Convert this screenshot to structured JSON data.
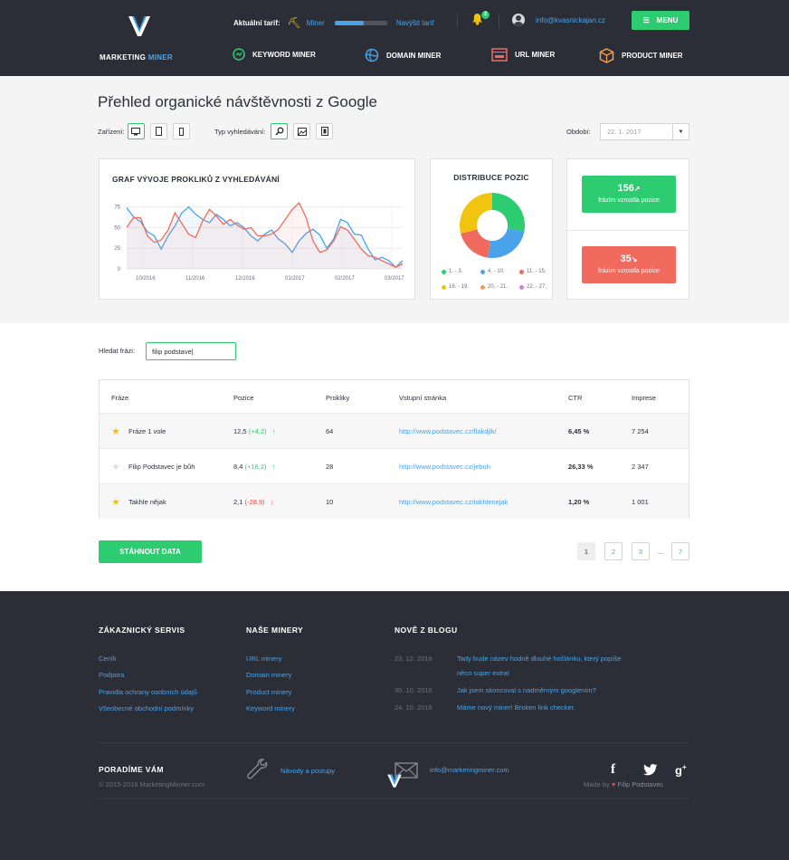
{
  "header": {
    "tariff_label": "Aktuální tarif:",
    "tariff_name": "Miner",
    "tariff_progress": 0.55,
    "upgrade_label": "Navýšit tarif",
    "notifications_count": "2",
    "user_email": "info@kvasnickajan.cz",
    "menu_label": "MENU"
  },
  "brand": {
    "name_part1": "MARKETING",
    "name_part2": "MINER"
  },
  "nav": [
    {
      "label": "KEYWORD MINER",
      "icon": "keyword-miner-icon"
    },
    {
      "label": "DOMAIN MINER",
      "icon": "domain-miner-icon"
    },
    {
      "label": "URL MINER",
      "icon": "url-miner-icon"
    },
    {
      "label": "PRODUCT MINER",
      "icon": "product-miner-icon"
    }
  ],
  "overview": {
    "title": "Přehled organické návštěvnosti z Google",
    "device_label": "Zařízení:",
    "search_type_label": "Typ vyhledávání:",
    "period_label": "Období:",
    "period_value": "22. 1. 2017"
  },
  "chart_data": [
    {
      "type": "line",
      "title": "GRAF VÝVOJE PROKLIKŮ Z VYHLEDÁVÁNÍ",
      "xlabel": "",
      "ylabel": "",
      "x_ticks": [
        "10/2016",
        "11/2016",
        "12/2016",
        "01/2017",
        "02/2017",
        "03/2017"
      ],
      "y_ticks": [
        0,
        25,
        50,
        75
      ],
      "ylim": [
        0,
        80
      ],
      "grid": true,
      "series": [
        {
          "color": "#4aa3e8",
          "values": [
            74,
            63,
            57,
            45,
            40,
            24,
            40,
            52,
            68,
            75,
            66,
            60,
            56,
            66,
            60,
            52,
            56,
            50,
            40,
            34,
            42,
            47,
            36,
            30,
            20,
            34,
            43,
            48,
            41,
            25,
            36,
            60,
            56,
            42,
            41,
            24,
            11,
            14,
            10,
            2,
            10
          ]
        },
        {
          "color": "#f06a5e",
          "values": [
            50,
            62,
            62,
            40,
            32,
            35,
            47,
            68,
            55,
            42,
            38,
            58,
            72,
            64,
            54,
            60,
            53,
            48,
            50,
            40,
            40,
            42,
            48,
            60,
            72,
            80,
            62,
            34,
            20,
            23,
            34,
            51,
            47,
            36,
            24,
            16,
            14,
            10,
            6,
            2,
            6
          ]
        }
      ]
    },
    {
      "type": "pie",
      "title": "DISTRIBUCE POZIC",
      "categories": [
        "1. - 3.",
        "4. - 10.",
        "11. - 15.",
        "16. - 19.",
        "20. - 21.",
        "22. - 27."
      ],
      "values": [
        28,
        24,
        19,
        29,
        0,
        0
      ],
      "colors": [
        "#2ecc71",
        "#4aa3e8",
        "#f06a5e",
        "#f1c40f",
        "#f39c4c",
        "#c882e0"
      ],
      "legend": "bottom"
    }
  ],
  "stats": {
    "up_value": "156",
    "up_label": "frázím vzrostla pozice",
    "down_value": "35",
    "down_label": "frázím vzrostla pozice"
  },
  "search": {
    "label": "Hledat frázi:",
    "value": "filip podstave|"
  },
  "table": {
    "headers": [
      "Fráze",
      "Pozice",
      "Prokliky",
      "Vstupní stránka",
      "CTR",
      "Imprese"
    ],
    "rows": [
      {
        "starred": true,
        "phrase": "Fráze 1 vole",
        "position": "12,5",
        "change": "(+4,2)",
        "direction": "up",
        "clicks": "64",
        "url": "http://www.podstavec.cz/flakdjlk/",
        "ctr": "6,45 %",
        "impressions": "7 254"
      },
      {
        "starred": false,
        "phrase": "Filip Podstavec je bůh",
        "position": "8,4",
        "change": "(+16,2)",
        "direction": "up",
        "clicks": "28",
        "url": "http://www.podstavec.cz/jebuh",
        "ctr": "26,33 %",
        "impressions": "2 347"
      },
      {
        "starred": true,
        "phrase": "Takhle nějak",
        "position": "2,1",
        "change": "(-28,9)",
        "direction": "down",
        "clicks": "10",
        "url": "http://www.podstavec.cz/takhlenejak",
        "ctr": "1,20 %",
        "impressions": "1 001"
      }
    ]
  },
  "download_label": "STÁHNOUT DATA",
  "pagination": [
    "1",
    "2",
    "3",
    "...",
    "7"
  ],
  "footer": {
    "col1": {
      "title": "ZÁKAZNICKÝ SERVIS",
      "links": [
        "Ceník",
        "Podpora",
        "Pravidla ochrany osobních údajů",
        "Všeobecné obchodní podmínky"
      ]
    },
    "col2": {
      "title": "NAŠE MINERY",
      "links": [
        "URL minery",
        "Domain minery",
        "Product minery",
        "Keyword minery"
      ]
    },
    "col3": {
      "title": "NOVĚ Z BLOGU",
      "posts": [
        {
          "date": "23. 12. 2016",
          "title_line1": "Tady bude název hodně dlouhé hočlánku, který popíše",
          "title_line2": "něco super extra!"
        },
        {
          "date": "30. 10. 2016",
          "title_line1": "Jak jsem skoncoval s nadměrným googlením?",
          "title_line2": ""
        },
        {
          "date": "24. 10. 2016",
          "title_line1": "Máme nový miner! Broken link checker.",
          "title_line2": ""
        }
      ]
    },
    "advice_title": "PORADÍME VÁM",
    "guides_link": "Návody a postupy",
    "contact_email": "info@markeringminer.com",
    "copyright": "© 2015-2016 MarketingMinner.com",
    "made_by_prefix": "Made by",
    "made_by_name": "Filip Podstavec"
  }
}
